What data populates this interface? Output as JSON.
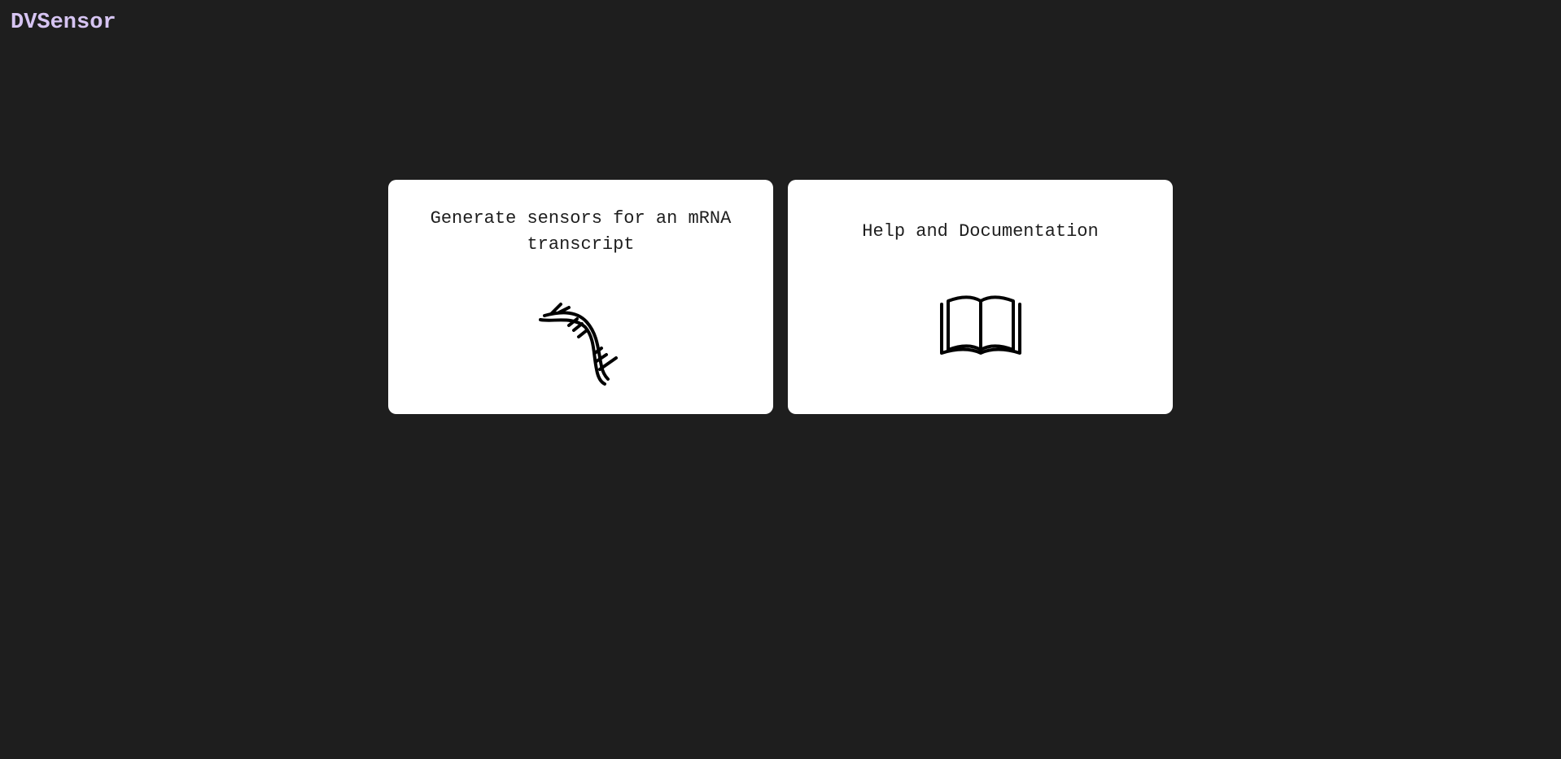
{
  "header": {
    "app_title": "DVSensor"
  },
  "cards": [
    {
      "label": "Generate sensors for an mRNA transcript",
      "icon": "dna-icon"
    },
    {
      "label": "Help and Documentation",
      "icon": "book-icon"
    }
  ],
  "colors": {
    "background": "#1e1e1e",
    "card": "#ffffff",
    "app_title": "#d6c4f2",
    "text": "#1e1e1e"
  }
}
